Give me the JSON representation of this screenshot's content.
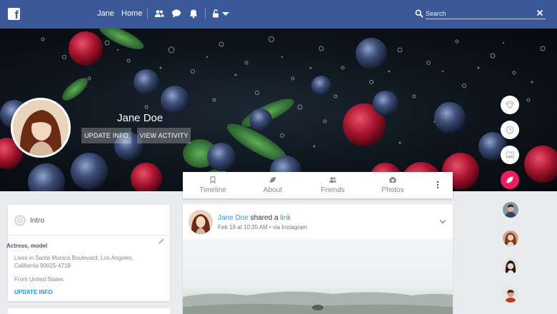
{
  "topbar": {
    "user_link": "Jane",
    "home_link": "Home",
    "search_placeholder": "Search",
    "brand_color": "#3b5998",
    "icons": [
      "friends-icon",
      "messages-icon",
      "notifications-icon",
      "lock-icon",
      "dropdown-caret-icon",
      "search-icon",
      "clear-icon"
    ]
  },
  "profile": {
    "name": "Jane Doe",
    "update_info_button": "UPDATE INFO",
    "view_activity_button": "VIEW ACTIVITY"
  },
  "side_actions": [
    {
      "icon": "diamond-icon"
    },
    {
      "icon": "clock-icon"
    },
    {
      "icon": "image-icon"
    },
    {
      "icon": "leaf-icon",
      "color": "#e91e63"
    }
  ],
  "tabs": [
    {
      "label": "Timeline",
      "icon": "bookmark-icon"
    },
    {
      "label": "About",
      "icon": "leaf-icon"
    },
    {
      "label": "Friends",
      "icon": "friends-icon"
    },
    {
      "label": "Photos",
      "icon": "camera-icon"
    }
  ],
  "intro": {
    "title": "Intro",
    "occupation": "Actress, model",
    "lives_line1": "Lives in Santa Monica Boulevard, Los Angeles,",
    "lives_line2": "California 90025-4718",
    "from": "From United States",
    "update_link": "UPDATE INFO"
  },
  "post": {
    "author": "Jane Doe",
    "action": "shared a",
    "object": "link",
    "meta": "Feb 19 at 10:35 AM • via Instagram"
  },
  "accent_color": "#2196f3"
}
